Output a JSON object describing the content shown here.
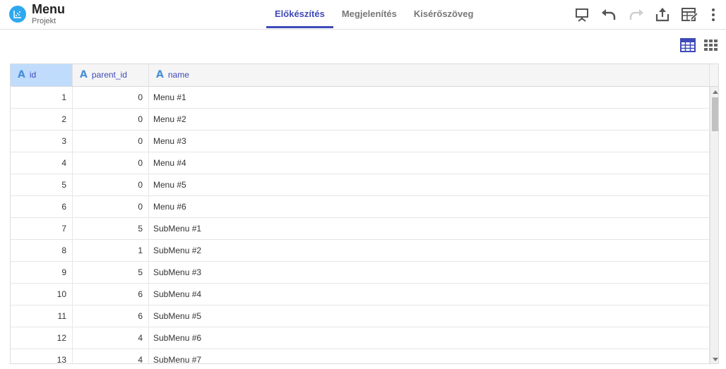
{
  "header": {
    "title": "Menu",
    "subtitle": "Projekt",
    "accent_color": "#3e4ab8",
    "logo_color": "#2fa8f0"
  },
  "tabs": [
    {
      "label": "Előkészítés",
      "active": true
    },
    {
      "label": "Megjelenítés",
      "active": false
    },
    {
      "label": "Kisérőszöveg",
      "active": false
    }
  ],
  "toolbar": [
    "presentation-icon",
    "undo-icon",
    "redo-icon",
    "share-icon",
    "edit-table-icon",
    "more-vert-icon"
  ],
  "view_toggle": [
    "table-view-icon",
    "grid-view-icon"
  ],
  "table": {
    "columns": [
      {
        "label": "id",
        "type_icon": "A"
      },
      {
        "label": "parent_id",
        "type_icon": "A"
      },
      {
        "label": "name",
        "type_icon": "A"
      }
    ],
    "rows": [
      {
        "id": "1",
        "parent_id": "0",
        "name": "Menu #1"
      },
      {
        "id": "2",
        "parent_id": "0",
        "name": "Menu #2"
      },
      {
        "id": "3",
        "parent_id": "0",
        "name": "Menu #3"
      },
      {
        "id": "4",
        "parent_id": "0",
        "name": "Menu #4"
      },
      {
        "id": "5",
        "parent_id": "0",
        "name": "Menu #5"
      },
      {
        "id": "6",
        "parent_id": "0",
        "name": "Menu #6"
      },
      {
        "id": "7",
        "parent_id": "5",
        "name": "SubMenu #1"
      },
      {
        "id": "8",
        "parent_id": "1",
        "name": "SubMenu #2"
      },
      {
        "id": "9",
        "parent_id": "5",
        "name": "SubMenu #3"
      },
      {
        "id": "10",
        "parent_id": "6",
        "name": "SubMenu #4"
      },
      {
        "id": "11",
        "parent_id": "6",
        "name": "SubMenu #5"
      },
      {
        "id": "12",
        "parent_id": "4",
        "name": "SubMenu #6"
      },
      {
        "id": "13",
        "parent_id": "4",
        "name": "SubMenu #7"
      }
    ]
  }
}
